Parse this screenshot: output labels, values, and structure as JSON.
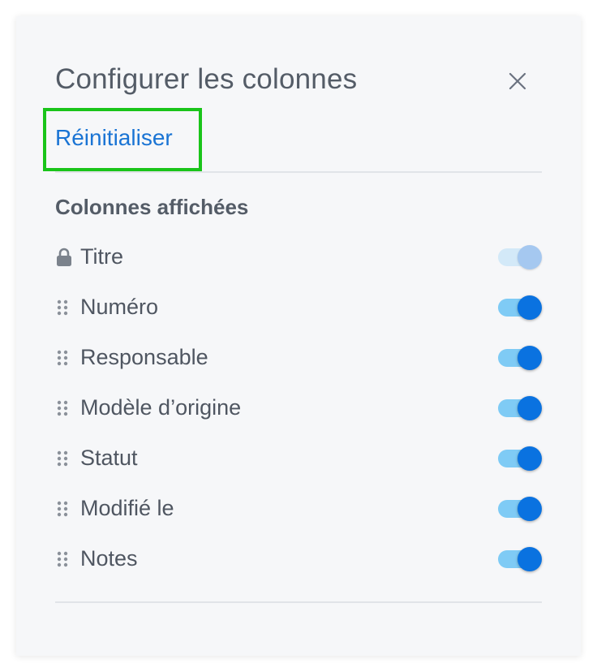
{
  "dialog": {
    "title": "Configurer les colonnes",
    "close_icon": "close-icon",
    "reset_label": "Réinitialiser",
    "highlight_color": "#1ac41a"
  },
  "section": {
    "title": "Colonnes affichées"
  },
  "columns": [
    {
      "label": "Titre",
      "icon": "lock-icon",
      "enabled": true,
      "locked": true
    },
    {
      "label": "Numéro",
      "icon": "drag-handle-icon",
      "enabled": true,
      "locked": false
    },
    {
      "label": "Responsable",
      "icon": "drag-handle-icon",
      "enabled": true,
      "locked": false
    },
    {
      "label": "Modèle d’origine",
      "icon": "drag-handle-icon",
      "enabled": true,
      "locked": false
    },
    {
      "label": "Statut",
      "icon": "drag-handle-icon",
      "enabled": true,
      "locked": false
    },
    {
      "label": "Modifié le",
      "icon": "drag-handle-icon",
      "enabled": true,
      "locked": false
    },
    {
      "label": "Notes",
      "icon": "drag-handle-icon",
      "enabled": true,
      "locked": false
    }
  ],
  "colors": {
    "accent": "#0a72e0",
    "link": "#1a74d4",
    "track_on": "#7fcbf5",
    "text": "#4f5661"
  }
}
